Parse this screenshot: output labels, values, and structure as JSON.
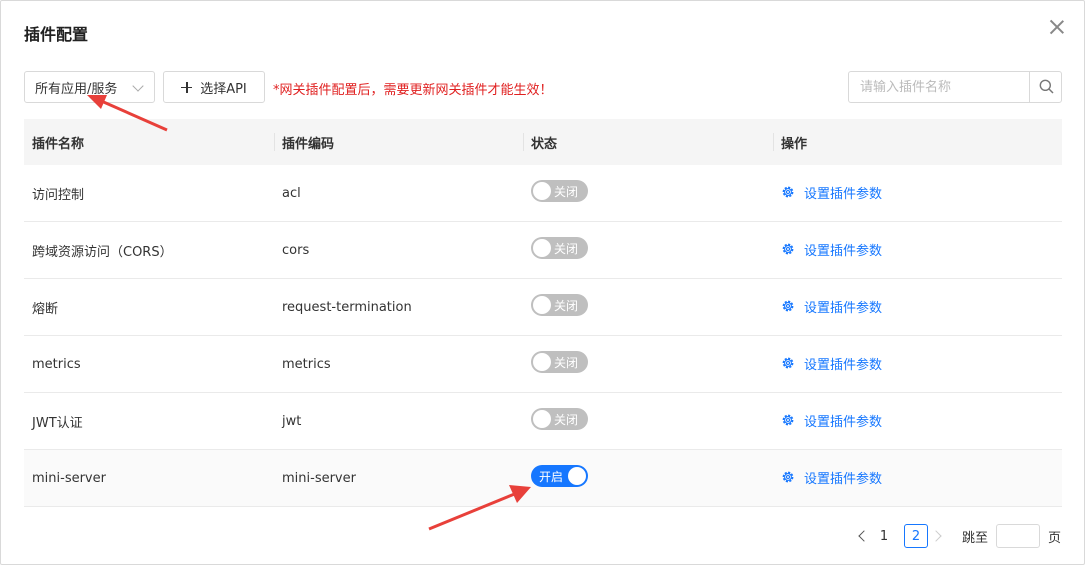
{
  "dialog": {
    "title": "插件配置"
  },
  "toolbar": {
    "scope_select": "所有应用/服务",
    "select_api_label": "选择API",
    "warning": "*网关插件配置后，需要更新网关插件才能生效！"
  },
  "search": {
    "placeholder": "请输入插件名称"
  },
  "table": {
    "headers": [
      "插件名称",
      "插件编码",
      "状态",
      "操作"
    ],
    "rows": [
      {
        "name": "访问控制",
        "code": "acl",
        "status": "关闭",
        "action": "设置插件参数"
      },
      {
        "name": "跨域资源访问（CORS）",
        "code": "cors",
        "status": "关闭",
        "action": "设置插件参数"
      },
      {
        "name": "熔断",
        "code": "request-termination",
        "status": "关闭",
        "action": "设置插件参数"
      },
      {
        "name": "metrics",
        "code": "metrics",
        "status": "关闭",
        "action": "设置插件参数"
      },
      {
        "name": "JWT认证",
        "code": "jwt",
        "status": "关闭",
        "action": "设置插件参数"
      },
      {
        "name": "mini-server",
        "code": "mini-server",
        "status": "开启",
        "action": "设置插件参数"
      }
    ]
  },
  "pagination": {
    "pages": [
      "1",
      "2"
    ],
    "current": "2",
    "jump_prefix": "跳至",
    "jump_suffix": "页"
  },
  "colors": {
    "primary": "#1677ff",
    "warning": "#e02020",
    "switch_off": "#bfbfbf",
    "annotation": "#e8403a"
  }
}
